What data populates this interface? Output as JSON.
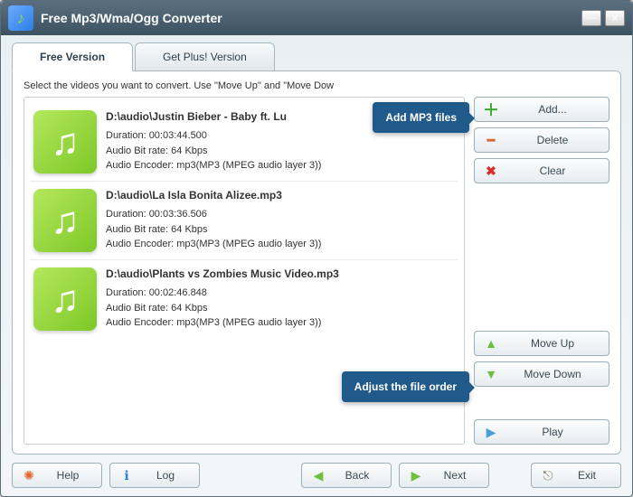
{
  "window": {
    "title": "Free Mp3/Wma/Ogg Converter"
  },
  "tabs": {
    "free": "Free Version",
    "plus": "Get Plus! Version"
  },
  "hint": "Select the videos you want to convert. Use \"Move Up\" and \"Move Dow",
  "files": [
    {
      "path": "D:\\audio\\Justin Bieber - Baby ft. Lu",
      "duration": "Duration: 00:03:44.500",
      "bitrate": "Audio Bit rate: 64 Kbps",
      "encoder": "Audio Encoder: mp3(MP3 (MPEG audio layer 3))"
    },
    {
      "path": "D:\\audio\\La Isla Bonita Alizee.mp3",
      "duration": "Duration: 00:03:36.506",
      "bitrate": "Audio Bit rate: 64 Kbps",
      "encoder": "Audio Encoder: mp3(MP3 (MPEG audio layer 3))"
    },
    {
      "path": "D:\\audio\\Plants vs Zombies Music Video.mp3",
      "duration": "Duration: 00:02:46.848",
      "bitrate": "Audio Bit rate: 64 Kbps",
      "encoder": "Audio Encoder: mp3(MP3 (MPEG audio layer 3))"
    }
  ],
  "buttons": {
    "add": "Add...",
    "delete": "Delete",
    "clear": "Clear",
    "moveup": "Move Up",
    "movedown": "Move Down",
    "play": "Play",
    "help": "Help",
    "log": "Log",
    "back": "Back",
    "next": "Next",
    "exit": "Exit"
  },
  "callouts": {
    "add": "Add MP3 files",
    "order": "Adjust the file order"
  }
}
